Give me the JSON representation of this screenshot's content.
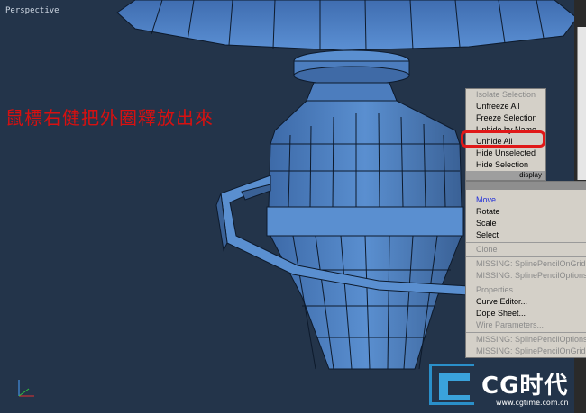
{
  "viewport": {
    "label": "Perspective",
    "annotation": "鼠標右健把外圈釋放出來"
  },
  "quad_menu_top": {
    "items": [
      {
        "label": "Isolate Selection",
        "disabled": true
      },
      {
        "label": "Unfreeze All",
        "disabled": false
      },
      {
        "label": "Freeze Selection",
        "disabled": false
      },
      {
        "label": "Unhide by Name",
        "disabled": false
      },
      {
        "label": "Unhide All",
        "disabled": false,
        "highlighted": true
      },
      {
        "label": "Hide Unselected",
        "disabled": false
      },
      {
        "label": "Hide Selection",
        "disabled": false
      }
    ],
    "title": "display"
  },
  "quad_menu_bottom": {
    "group1": [
      {
        "label": "Move",
        "active": true
      },
      {
        "label": "Rotate"
      },
      {
        "label": "Scale"
      },
      {
        "label": "Select"
      }
    ],
    "group2": [
      {
        "label": "Clone",
        "disabled": true
      },
      {
        "label": "MISSING: SplinePencilOnGrid`Sp",
        "disabled": true
      },
      {
        "label": "MISSING: SplinePencilOptions`Sp",
        "disabled": true
      }
    ],
    "group3": [
      {
        "label": "Properties...",
        "disabled": true
      },
      {
        "label": "Curve Editor...",
        "disabled": false
      },
      {
        "label": "Dope Sheet...",
        "disabled": false
      },
      {
        "label": "Wire Parameters...",
        "disabled": true
      }
    ],
    "group4": [
      {
        "label": "MISSING: SplinePencilOptions`Sp",
        "disabled": true
      },
      {
        "label": "MISSING: SplinePencilOnGrid`Sp",
        "disabled": true
      }
    ]
  },
  "logo": {
    "text": "CG时代",
    "url": "www.cgtime.com.cn"
  },
  "colors": {
    "highlight_ring": "#e01818",
    "annotation": "#d81010",
    "model": "#4a78b8",
    "viewport_bg": "#23344a"
  }
}
